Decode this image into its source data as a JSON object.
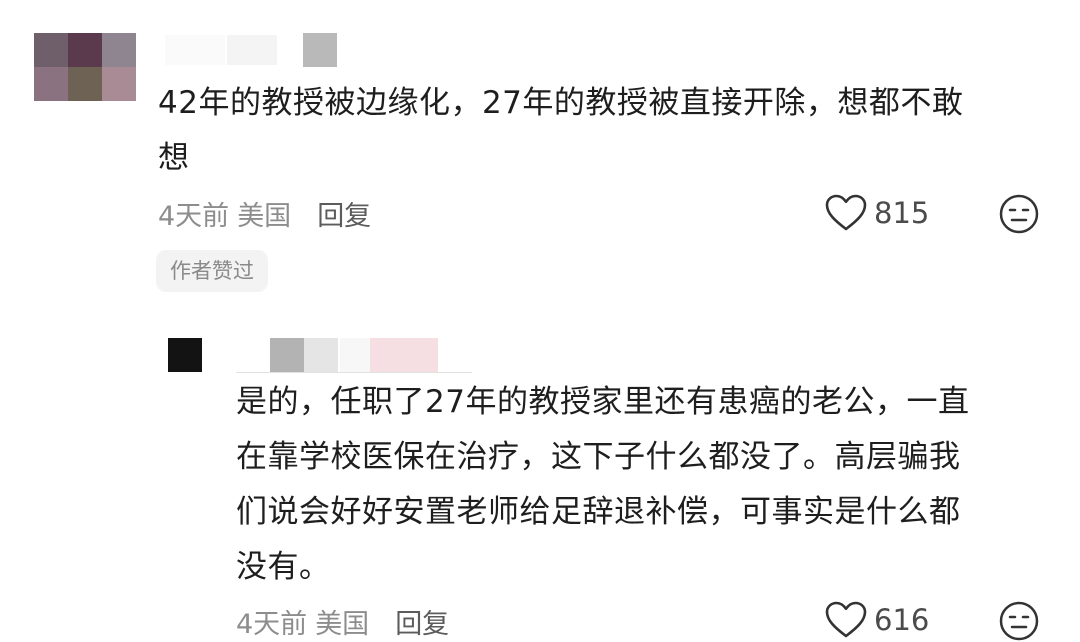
{
  "comment": {
    "text_lines": [
      "42年的教授被边缘化，27年的教授被直接开除，想都不敢",
      "想"
    ],
    "time": "4天前",
    "location": "美国",
    "reply_label": "回复",
    "like_count": "815",
    "author_badge": "作者赞过"
  },
  "reply": {
    "text_lines": [
      "是的，任职了27年的教授家里还有患癌的老公，一直",
      "在靠学校医保在治疗，这下子什么都没了。高层骗我",
      "们说会好好安置老师给足辞退补偿，可事实是什么都",
      "没有。"
    ],
    "time": "4天前",
    "location": "美国",
    "reply_label": "回复",
    "like_count": "616"
  },
  "icons": {
    "like": "heart-outline-icon",
    "dislike": "neutral-face-icon"
  },
  "colors": {
    "text": "#1e1e1e",
    "meta": "#8d8d8d",
    "badge_bg": "#f3f3f3"
  }
}
